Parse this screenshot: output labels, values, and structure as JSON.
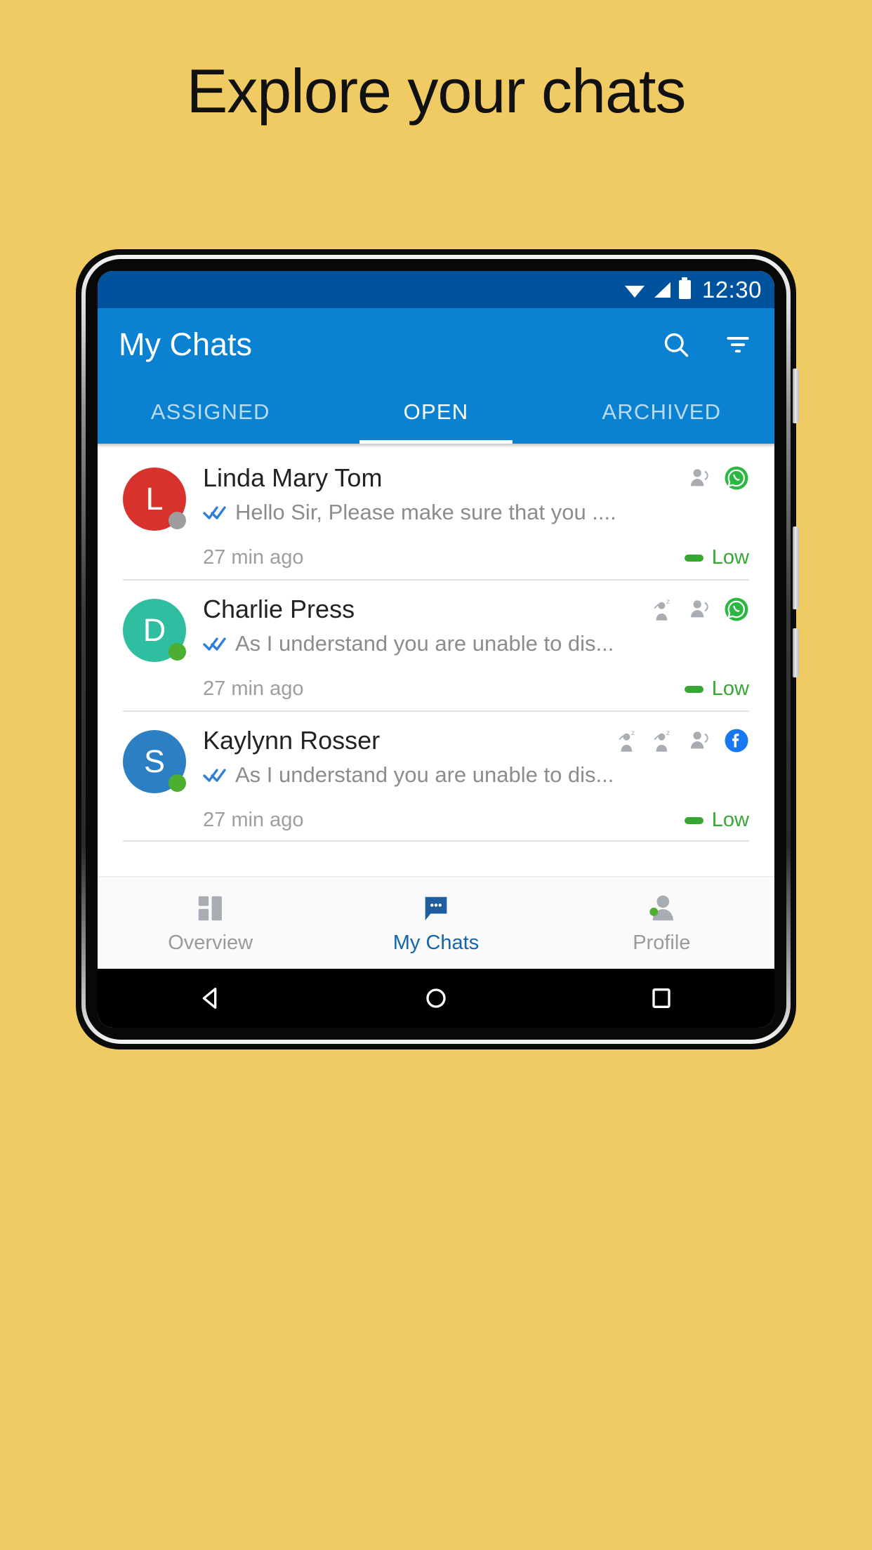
{
  "page": {
    "background_color": "#f0cb64",
    "headline": "Explore your chats"
  },
  "phone": {
    "statusbar": {
      "time": "12:30",
      "background_color": "#00529c",
      "icons": [
        "wifi-icon",
        "signal-icon",
        "battery-icon"
      ]
    },
    "appbar": {
      "title": "My Chats",
      "background_color": "#0a81d1",
      "search_icon": "search-icon",
      "filter_icon": "filter-icon"
    },
    "tabs": [
      {
        "label": "ASSIGNED",
        "active": false
      },
      {
        "label": "OPEN",
        "active": true
      },
      {
        "label": "ARCHIVED",
        "active": false
      }
    ],
    "chats": [
      {
        "avatar_letter": "L",
        "avatar_color": "#d8322c",
        "presence_color": "#9e9e9e",
        "name": "Linda Mary Tom",
        "snippet": "Hello Sir, Please make sure that you ....",
        "time": "27 min ago",
        "priority_label": "Low",
        "priority_color": "#36a832",
        "read_status_icon": "double-check-icon",
        "badges": [
          "contact-icon",
          "whatsapp-icon"
        ]
      },
      {
        "avatar_letter": "D",
        "avatar_color": "#2fbfa0",
        "presence_color": "#4caf32",
        "name": "Charlie Press",
        "snippet": "As I understand you are unable to dis...",
        "time": "27 min ago",
        "priority_label": "Low",
        "priority_color": "#36a832",
        "read_status_icon": "double-check-icon",
        "badges": [
          "snooze-icon",
          "contact-icon",
          "whatsapp-icon"
        ]
      },
      {
        "avatar_letter": "S",
        "avatar_color": "#2d7fc4",
        "presence_color": "#4caf32",
        "name": "Kaylynn Rosser",
        "snippet": "As I understand you are unable to dis...",
        "time": "27 min ago",
        "priority_label": "Low",
        "priority_color": "#36a832",
        "read_status_icon": "double-check-icon",
        "badges": [
          "snooze-icon",
          "snooze-icon",
          "contact-icon",
          "facebook-icon"
        ]
      }
    ],
    "bottom_nav": [
      {
        "label": "Overview",
        "icon": "dashboard-icon",
        "active": false
      },
      {
        "label": "My Chats",
        "icon": "chat-bubble-icon",
        "active": true
      },
      {
        "label": "Profile",
        "icon": "profile-icon",
        "active": false
      }
    ],
    "android_nav": [
      {
        "icon": "back-icon"
      },
      {
        "icon": "home-icon"
      },
      {
        "icon": "recents-icon"
      }
    ]
  }
}
